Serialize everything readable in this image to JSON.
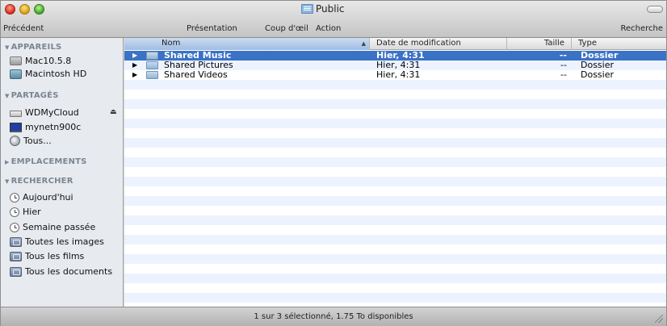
{
  "window": {
    "title": "Public",
    "controls": [
      "close",
      "minimize",
      "zoom"
    ]
  },
  "toolbar": {
    "back_label": "Précédent",
    "presentation_label": "Présentation",
    "quicklook_label": "Coup d'œil",
    "action_label": "Action",
    "search_label": "Recherche"
  },
  "sidebar": {
    "sections": [
      {
        "label": "APPAREILS",
        "expanded": true
      },
      {
        "label": "PARTAGÉS",
        "expanded": true
      },
      {
        "label": "EMPLACEMENTS",
        "expanded": false
      },
      {
        "label": "RECHERCHER",
        "expanded": true
      }
    ],
    "items": [
      {
        "label": "Mac10.5.8",
        "icon": "disk-icon"
      },
      {
        "label": "Macintosh HD",
        "icon": "hard-drive-icon"
      },
      {
        "label": "WDMyCloud",
        "icon": "network-drive-icon",
        "eject": "⏏"
      },
      {
        "label": "mynetn900c",
        "icon": "monitor-icon"
      },
      {
        "label": "Tous...",
        "icon": "network-globe-icon"
      },
      {
        "label": "Aujourd'hui",
        "icon": "clock-icon"
      },
      {
        "label": "Hier",
        "icon": "clock-icon"
      },
      {
        "label": "Semaine passée",
        "icon": "clock-icon"
      },
      {
        "label": "Toutes les images",
        "icon": "smart-folder-icon"
      },
      {
        "label": "Tous les films",
        "icon": "smart-folder-icon"
      },
      {
        "label": "Tous les documents",
        "icon": "smart-folder-icon"
      }
    ]
  },
  "list": {
    "columns": {
      "name": "Nom",
      "date": "Date de modification",
      "size": "Taille",
      "type": "Type"
    },
    "sorted_by": "name",
    "rows": [
      {
        "name": "Shared Music",
        "date": "Hier, 4:31",
        "size": "--",
        "type": "Dossier",
        "selected": true
      },
      {
        "name": "Shared Pictures",
        "date": "Hier, 4:31",
        "size": "--",
        "type": "Dossier",
        "selected": false
      },
      {
        "name": "Shared Videos",
        "date": "Hier, 4:31",
        "size": "--",
        "type": "Dossier",
        "selected": false
      }
    ],
    "selection_color": "#3a72c6",
    "stripe_color": "#edf3fe"
  },
  "status": {
    "text": "1 sur 3 sélectionné, 1.75 To disponibles"
  }
}
